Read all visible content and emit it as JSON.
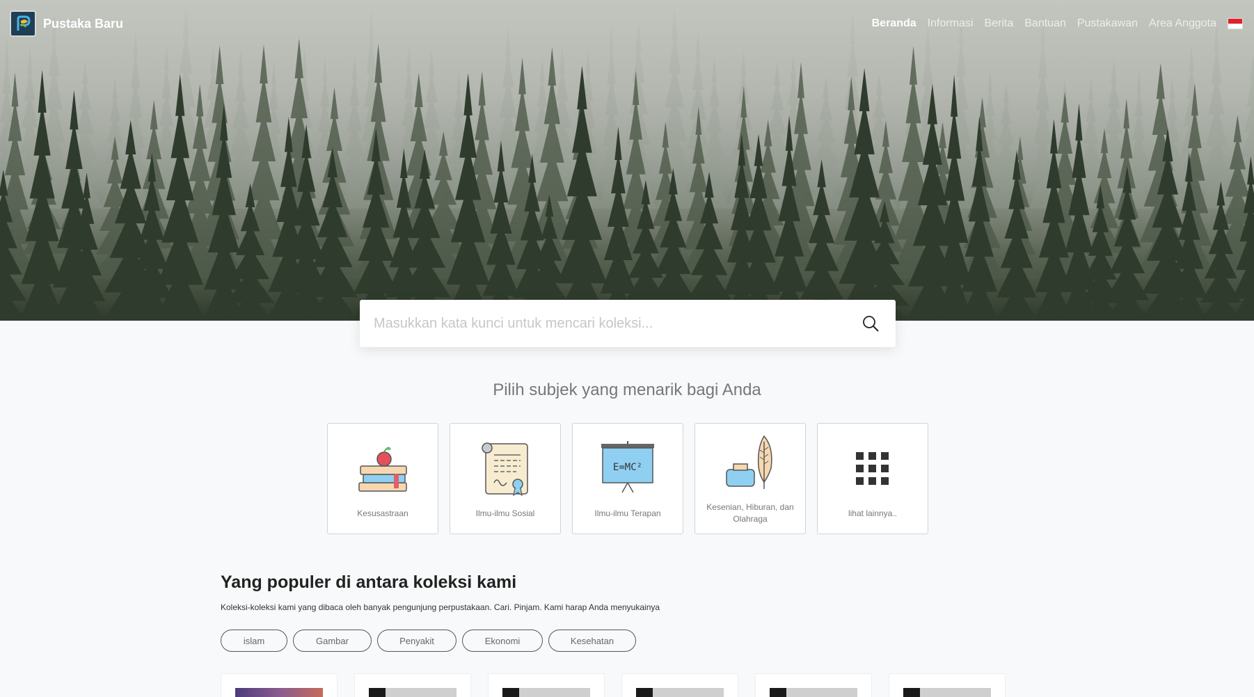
{
  "header": {
    "brand_name": "Pustaka Baru",
    "nav": [
      {
        "label": "Beranda",
        "active": true
      },
      {
        "label": "Informasi",
        "active": false
      },
      {
        "label": "Berita",
        "active": false
      },
      {
        "label": "Bantuan",
        "active": false
      },
      {
        "label": "Pustakawan",
        "active": false
      },
      {
        "label": "Area Anggota",
        "active": false
      }
    ],
    "language_flag": "indonesia-flag-icon"
  },
  "search": {
    "placeholder": "Masukkan kata kunci untuk mencari koleksi...",
    "value": "",
    "icon": "search-icon"
  },
  "subjects": {
    "title": "Pilih subjek yang menarik bagi Anda",
    "items": [
      {
        "label": "Kesusastraan",
        "icon": "books-apple-icon"
      },
      {
        "label": "Ilmu-ilmu Sosial",
        "icon": "certificate-scroll-icon"
      },
      {
        "label": "Ilmu-ilmu Terapan",
        "icon": "blackboard-emc2-icon"
      },
      {
        "label": "Kesenian, Hiburan, dan Olahraga",
        "icon": "ink-quill-icon"
      },
      {
        "label": "lihat lainnya..",
        "icon": "grid-icon"
      }
    ]
  },
  "popular": {
    "title": "Yang populer di antara koleksi kami",
    "description": "Koleksi-koleksi kami yang dibaca oleh banyak pengunjung perpustakaan. Cari. Pinjam. Kami harap Anda menyukainya",
    "tags": [
      "islam",
      "Gambar",
      "Penyakit",
      "Ekonomi",
      "Kesehatan"
    ]
  },
  "colors": {
    "page_background": "#f8f9fa",
    "nav_active": "#ffffff",
    "card_border": "#cfd3d7"
  }
}
